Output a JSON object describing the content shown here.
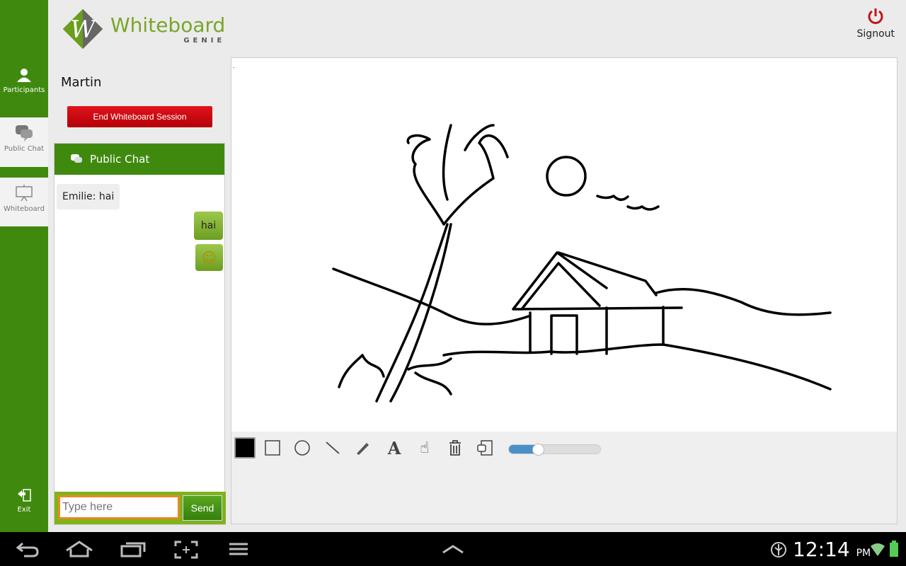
{
  "app": {
    "logo_main": "Whiteboard",
    "logo_sub": "GENIE",
    "signout": "Signout"
  },
  "nav": {
    "participants": "Participants",
    "public_chat": "Public Chat",
    "whiteboard": "Whiteboard",
    "exit": "Exit"
  },
  "panel": {
    "user": "Martin",
    "end_session": "End Whiteboard Session"
  },
  "chat": {
    "title": "Public Chat",
    "messages": [
      {
        "from": "Emilie",
        "text": "Emilie: hai"
      },
      {
        "text": "hai",
        "mine": true
      },
      {
        "text": "☺",
        "mine": true,
        "icon": "smiley-icon"
      }
    ],
    "placeholder": "Type here",
    "send": "Send"
  },
  "toolbar": {
    "selected_color": "#000000",
    "tools": [
      "color",
      "rectangle",
      "circle",
      "line",
      "pencil",
      "text",
      "hand",
      "trash",
      "copy"
    ],
    "stroke_level": 0.33
  },
  "status": {
    "time": "12:14",
    "ampm": "PM"
  },
  "colors": {
    "accent": "#3f8a0e",
    "danger": "#c80a10"
  }
}
